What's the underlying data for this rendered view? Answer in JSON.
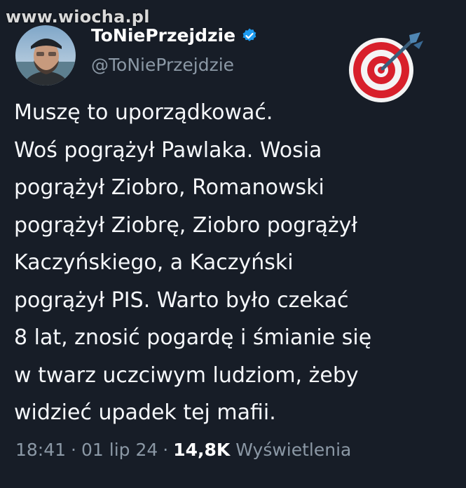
{
  "watermark": "www.wiocha.pl",
  "author": {
    "display_name": "ToNiePrzejdzie",
    "handle": "@ToNiePrzejdzie"
  },
  "icons": {
    "verified": "verified-badge-icon",
    "target": "direct-hit-target-icon"
  },
  "colors": {
    "background": "#171d27",
    "text": "#f5f7fa",
    "muted": "#8b98a5",
    "verified": "#1d9bf0"
  },
  "tweet": {
    "lines": [
      "Muszę to uporządkować.",
      "Woś pogrążył Pawlaka. Wosia",
      "pogrążył Ziobro, Romanowski",
      "pogrążył Ziobrę, Ziobro pogrążył",
      "Kaczyńskiego, a Kaczyński",
      "pogrążył PIS. Warto było czekać",
      "8 lat, znosić pogardę i śmianie się",
      "w twarz uczciwym ludziom, żeby",
      "widzieć upadek tej mafii."
    ]
  },
  "meta": {
    "time": "18:41",
    "separator": "·",
    "date": "01 lip 24",
    "views_count": "14,8K",
    "views_label": "Wyświetlenia"
  }
}
